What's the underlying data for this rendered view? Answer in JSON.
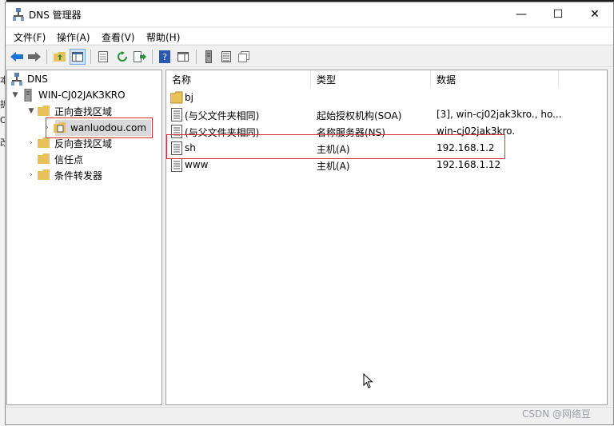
{
  "window": {
    "title": "DNS 管理器",
    "controls": {
      "minimize": "—",
      "maximize": "☐",
      "close": "✕"
    }
  },
  "menu": [
    "文件(F)",
    "操作(A)",
    "查看(V)",
    "帮助(H)"
  ],
  "background_chars": [
    "本",
    "拆",
    "O",
    "改"
  ],
  "tree": {
    "root": "DNS",
    "server": "WIN-CJ02JAK3KRO",
    "forward_zone": "正向查找区域",
    "selected_zone": "wanluodou.com",
    "reverse_zone": "反向查找区域",
    "trust_points": "信任点",
    "conditional_forwarders": "条件转发器"
  },
  "list": {
    "headers": {
      "name": "名称",
      "type": "类型",
      "data": "数据"
    },
    "rows": [
      {
        "icon": "folder-icon",
        "name": "bj",
        "type": "",
        "data": ""
      },
      {
        "icon": "record-icon",
        "name": "(与父文件夹相同)",
        "type": "起始授权机构(SOA)",
        "data": "[3], win-cj02jak3kro., ho..."
      },
      {
        "icon": "record-icon",
        "name": "(与父文件夹相同)",
        "type": "名称服务器(NS)",
        "data": "win-cj02jak3kro."
      },
      {
        "icon": "record-icon",
        "name": "sh",
        "type": "主机(A)",
        "data": "192.168.1.2"
      },
      {
        "icon": "record-icon",
        "name": "www",
        "type": "主机(A)",
        "data": "192.168.1.12"
      }
    ]
  },
  "watermark": "CSDN @网络豆",
  "colors": {
    "highlight_box": "#d7303a",
    "folder": "#e8c15a",
    "selection": "#d9d9d9"
  }
}
